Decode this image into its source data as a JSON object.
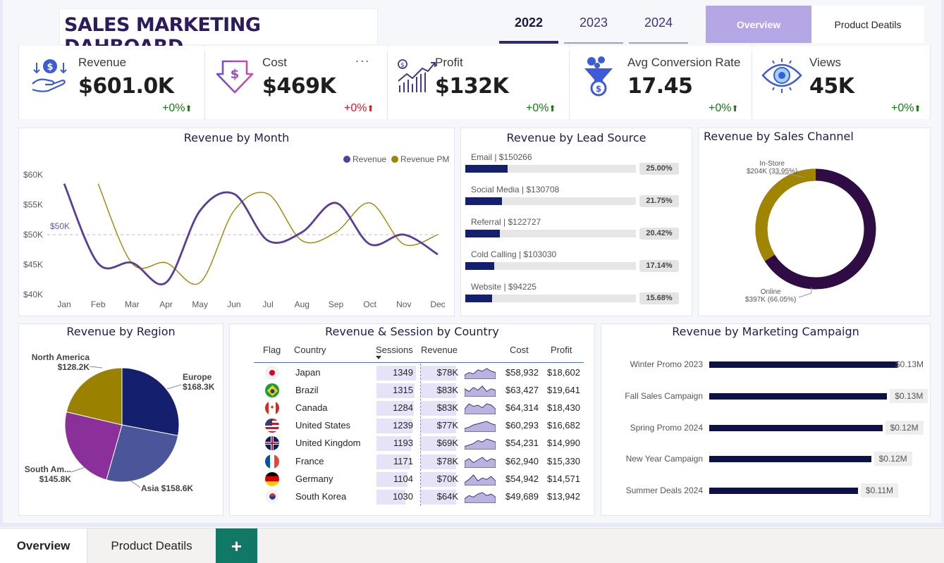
{
  "header": {
    "title": "SALES MARKETING DAHBOARD",
    "years": [
      "2022",
      "2023",
      "2024"
    ],
    "active_year": "2022",
    "nav_overview": "Overview",
    "nav_product": "Product Deatils"
  },
  "kpis": [
    {
      "label": "Revenue",
      "value": "$601.0K",
      "change": "+0%",
      "change_color": "#107c10",
      "icon": "revenue-hand-icon"
    },
    {
      "label": "Cost",
      "value": "$469K",
      "change": "+0%",
      "change_color": "#e81123",
      "icon": "cost-arrow-icon"
    },
    {
      "label": "Profit",
      "value": "$132K",
      "change": "+0%",
      "change_color": "#107c10",
      "icon": "profit-chart-icon"
    },
    {
      "label": "Avg Conversion Rate",
      "value": "17.45",
      "change": "+0%",
      "change_color": "#107c10",
      "icon": "funnel-icon"
    },
    {
      "label": "Views",
      "value": "45K",
      "change": "+0%",
      "change_color": "#107c10",
      "icon": "eye-icon"
    }
  ],
  "kpi_more": "...",
  "up_arrow": "⬆",
  "revenue_by_month": {
    "title": "Revenue by Month",
    "legend": [
      "Revenue",
      "Revenue PM"
    ],
    "ref_label": "$50K",
    "ytick_labels": [
      "$60K",
      "$55K",
      "$50K",
      "$45K",
      "$40K"
    ]
  },
  "lead_source": {
    "title": "Revenue by Lead Source",
    "items": [
      {
        "label": "Email | $150266",
        "pct": "25.00%"
      },
      {
        "label": "Social Media | $130708",
        "pct": "21.75%"
      },
      {
        "label": "Referral | $122727",
        "pct": "20.42%"
      },
      {
        "label": "Cold Calling | $103030",
        "pct": "17.14%"
      },
      {
        "label": "Website | $94225",
        "pct": "15.68%"
      }
    ]
  },
  "sales_channel": {
    "title": "Revenue by Sales Channel",
    "instore_name": "In-Store",
    "instore_val": "$204K (33.95%)",
    "online_name": "Online",
    "online_val": "$397K (66.05%)"
  },
  "region": {
    "title": "Revenue by Region",
    "labels": {
      "na_name": "North America",
      "na_val": "$128.2K",
      "eu_name": "Europe",
      "eu_val": "$168.3K",
      "sa_name": "South Am...",
      "sa_val": "$145.8K",
      "asia": "Asia $158.6K"
    }
  },
  "country": {
    "title": "Revenue & Session by Country",
    "headers": {
      "flag": "Flag",
      "country": "Country",
      "sessions": "Sessions",
      "revenue": "Revenue",
      "cost": "Cost",
      "profit": "Profit"
    },
    "rows": [
      {
        "country": "Japan",
        "sessions": "1349",
        "revenue": "$78K",
        "cost": "$58,932",
        "profit": "$18,602"
      },
      {
        "country": "Brazil",
        "sessions": "1315",
        "revenue": "$83K",
        "cost": "$63,427",
        "profit": "$19,641"
      },
      {
        "country": "Canada",
        "sessions": "1284",
        "revenue": "$83K",
        "cost": "$64,314",
        "profit": "$18,430"
      },
      {
        "country": "United States",
        "sessions": "1239",
        "revenue": "$77K",
        "cost": "$60,293",
        "profit": "$16,682"
      },
      {
        "country": "United Kingdom",
        "sessions": "1193",
        "revenue": "$69K",
        "cost": "$54,231",
        "profit": "$14,990"
      },
      {
        "country": "France",
        "sessions": "1171",
        "revenue": "$78K",
        "cost": "$62,940",
        "profit": "$15,330"
      },
      {
        "country": "Germany",
        "sessions": "1104",
        "revenue": "$70K",
        "cost": "$54,942",
        "profit": "$14,571"
      },
      {
        "country": "South Korea",
        "sessions": "1030",
        "revenue": "$64K",
        "cost": "$49,689",
        "profit": "$13,942"
      }
    ]
  },
  "campaign": {
    "title": "Revenue by Marketing Campaign"
  },
  "bottom_tabs": {
    "overview": "Overview",
    "product": "Product Deatils",
    "add": "+"
  },
  "colors": {
    "revenue_line": "#5a3d99",
    "revenue_pm_line": "#a08600",
    "online": "#300c45",
    "instore": "#a08600",
    "north_america": "#9a8200",
    "europe": "#14206e",
    "asia": "#4a5699",
    "south_america": "#8b2f9a",
    "accent": "#b5a6e6"
  },
  "chart_data": [
    {
      "type": "line",
      "title": "Revenue by Month",
      "x": [
        "Jan",
        "Feb",
        "Mar",
        "Apr",
        "May",
        "Jun",
        "Jul",
        "Aug",
        "Sep",
        "Oct",
        "Nov",
        "Dec"
      ],
      "series": [
        {
          "name": "Revenue",
          "values": [
            58.5,
            45.2,
            45.3,
            42.0,
            54.0,
            56.8,
            49.0,
            50.4,
            55.3,
            48.4,
            50.0,
            46.7
          ]
        },
        {
          "name": "Revenue PM",
          "values": [
            null,
            58.5,
            45.2,
            45.3,
            42.0,
            54.0,
            56.8,
            49.0,
            50.4,
            55.3,
            48.4,
            50.0
          ]
        }
      ],
      "reference_line": 50,
      "ylim": [
        40,
        62
      ],
      "yticks": [
        40,
        45,
        50,
        55,
        60
      ],
      "legend": "top-right"
    },
    {
      "type": "bar",
      "orientation": "horizontal",
      "title": "Revenue by Lead Source",
      "categories": [
        "Email",
        "Social Media",
        "Referral",
        "Cold Calling",
        "Website"
      ],
      "values": [
        150266,
        130708,
        122727,
        103030,
        94225
      ],
      "percentages": [
        25.0,
        21.75,
        20.42,
        17.14,
        15.68
      ]
    },
    {
      "type": "pie",
      "subtype": "donut",
      "title": "Revenue by Sales Channel",
      "categories": [
        "In-Store",
        "Online"
      ],
      "values": [
        204,
        397
      ],
      "percentages": [
        33.95,
        66.05
      ]
    },
    {
      "type": "pie",
      "title": "Revenue by Region",
      "categories": [
        "Europe",
        "Asia",
        "South America",
        "North America"
      ],
      "values": [
        168.3,
        158.6,
        145.8,
        128.2
      ]
    },
    {
      "type": "table",
      "title": "Revenue & Session by Country",
      "columns": [
        "Country",
        "Sessions",
        "Revenue",
        "Cost",
        "Profit"
      ],
      "sessions_max": 1349,
      "spark": [
        [
          3,
          5,
          4,
          7,
          6,
          8,
          6,
          5
        ],
        [
          6,
          4,
          7,
          5,
          8,
          4,
          6,
          5
        ],
        [
          4,
          8,
          6,
          7,
          5,
          8,
          7,
          4
        ],
        [
          3,
          4,
          6,
          7,
          8,
          9,
          7,
          6
        ],
        [
          2,
          3,
          4,
          6,
          5,
          7,
          6,
          5
        ],
        [
          5,
          7,
          4,
          6,
          8,
          5,
          7,
          6
        ],
        [
          2,
          4,
          7,
          3,
          5,
          4,
          6,
          3
        ],
        [
          3,
          5,
          4,
          6,
          7,
          5,
          6,
          4
        ]
      ]
    },
    {
      "type": "bar",
      "orientation": "horizontal",
      "title": "Revenue by Marketing Campaign",
      "categories": [
        "Winter Promo 2023",
        "Fall Sales Campaign",
        "Spring Promo 2024",
        "New Year Campaign",
        "Summer Deals 2024"
      ],
      "values": [
        0.13,
        0.13,
        0.12,
        0.12,
        0.11
      ],
      "value_labels": [
        "$0.13M",
        "$0.13M",
        "$0.12M",
        "$0.12M",
        "$0.11M"
      ],
      "bar_fraction": [
        1.0,
        0.945,
        0.92,
        0.86,
        0.79
      ]
    }
  ]
}
